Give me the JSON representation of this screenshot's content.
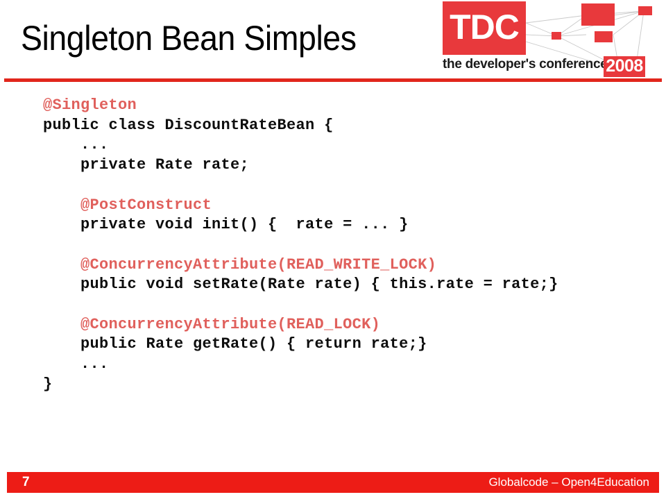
{
  "slide": {
    "title": "Singleton Bean Simples",
    "accent_red": "#e1261c",
    "logo_red": "#e8393c",
    "annotation_red": "#e0605c",
    "footer_red": "#ed1c16",
    "code_color": "#0d0d0d"
  },
  "logo": {
    "mark_text": "TDC",
    "tagline": "the developer's conference",
    "year": "2008"
  },
  "code": {
    "lines": [
      {
        "text": "@Singleton",
        "kind": "annotation"
      },
      {
        "text": "public class DiscountRateBean {",
        "kind": "code"
      },
      {
        "text": "    ...",
        "kind": "code"
      },
      {
        "text": "    private Rate rate;",
        "kind": "code"
      },
      {
        "text": " ",
        "kind": "blank"
      },
      {
        "text": "    @PostConstruct",
        "kind": "annotation"
      },
      {
        "text": "    private void init() {  rate = ... }",
        "kind": "code"
      },
      {
        "text": " ",
        "kind": "blank"
      },
      {
        "text": "    @ConcurrencyAttribute(READ_WRITE_LOCK)",
        "kind": "annotation"
      },
      {
        "text": "    public void setRate(Rate rate) { this.rate = rate;}",
        "kind": "code"
      },
      {
        "text": " ",
        "kind": "blank"
      },
      {
        "text": "    @ConcurrencyAttribute(READ_LOCK)",
        "kind": "annotation"
      },
      {
        "text": "    public Rate getRate() { return rate;}",
        "kind": "code"
      },
      {
        "text": "    ...",
        "kind": "code"
      },
      {
        "text": "}",
        "kind": "code"
      }
    ]
  },
  "footer": {
    "page_number": "7",
    "credit": "Globalcode – Open4Education"
  }
}
